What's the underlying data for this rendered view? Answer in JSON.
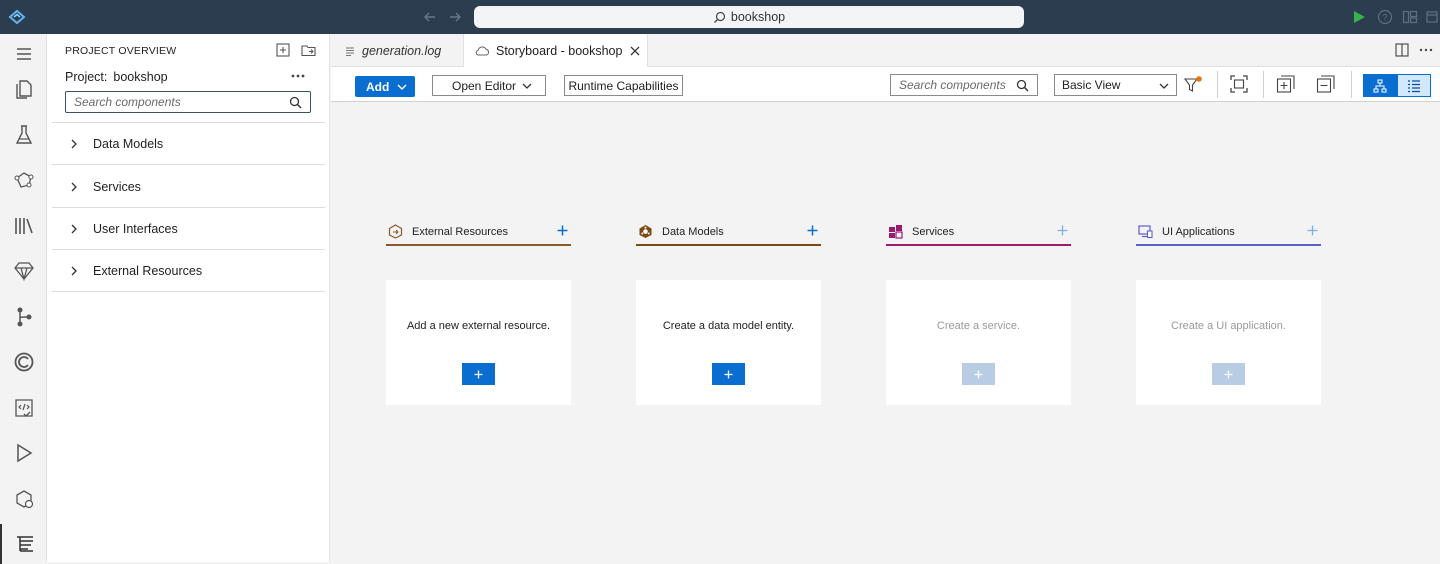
{
  "titlebar": {
    "search_text": "bookshop",
    "icons": [
      "app-logo-icon",
      "arrow-left-icon",
      "arrow-right-icon",
      "search-icon",
      "run-icon",
      "help-icon",
      "layout-icon"
    ]
  },
  "activity_bar": {
    "items": [
      "menu-icon",
      "explorer-icon",
      "flask-icon",
      "graph-icon",
      "library-icon",
      "diamond-icon",
      "source-control-icon",
      "cloud-foundry-icon",
      "code-check-icon",
      "run-debug-icon",
      "deploy-icon",
      "storyboard-icon"
    ]
  },
  "side_panel": {
    "title": "PROJECT OVERVIEW",
    "project_label": "Project:",
    "project_name": "bookshop",
    "search_placeholder": "Search components",
    "tree_items": [
      "Data Models",
      "Services",
      "User Interfaces",
      "External Resources"
    ]
  },
  "tabs": [
    {
      "label": "generation.log",
      "active": false
    },
    {
      "label": "Storyboard - bookshop",
      "active": true
    }
  ],
  "toolbar": {
    "add_label": "Add",
    "open_editor_label": "Open Editor",
    "runtime_label": "Runtime Capabilities",
    "search_placeholder": "Search components",
    "view_selected": "Basic View"
  },
  "columns": [
    {
      "title": "External Resources",
      "accent": "#8b5a2b",
      "icon": "external-resource-icon",
      "card_text": "Add a new external resource.",
      "enabled": true
    },
    {
      "title": "Data Models",
      "accent": "#7a4a12",
      "icon": "data-model-icon",
      "card_text": "Create a data model entity.",
      "enabled": true
    },
    {
      "title": "Services",
      "accent": "#9b1c6e",
      "icon": "service-icon",
      "card_text": "Create a service.",
      "enabled": false
    },
    {
      "title": "UI Applications",
      "accent": "#5b5fc7",
      "icon": "ui-application-icon",
      "card_text": "Create a UI application.",
      "enabled": false
    }
  ],
  "colors": {
    "primary": "#0a6ed1",
    "titlebar": "#2b3d4f",
    "run": "#37b24d"
  }
}
